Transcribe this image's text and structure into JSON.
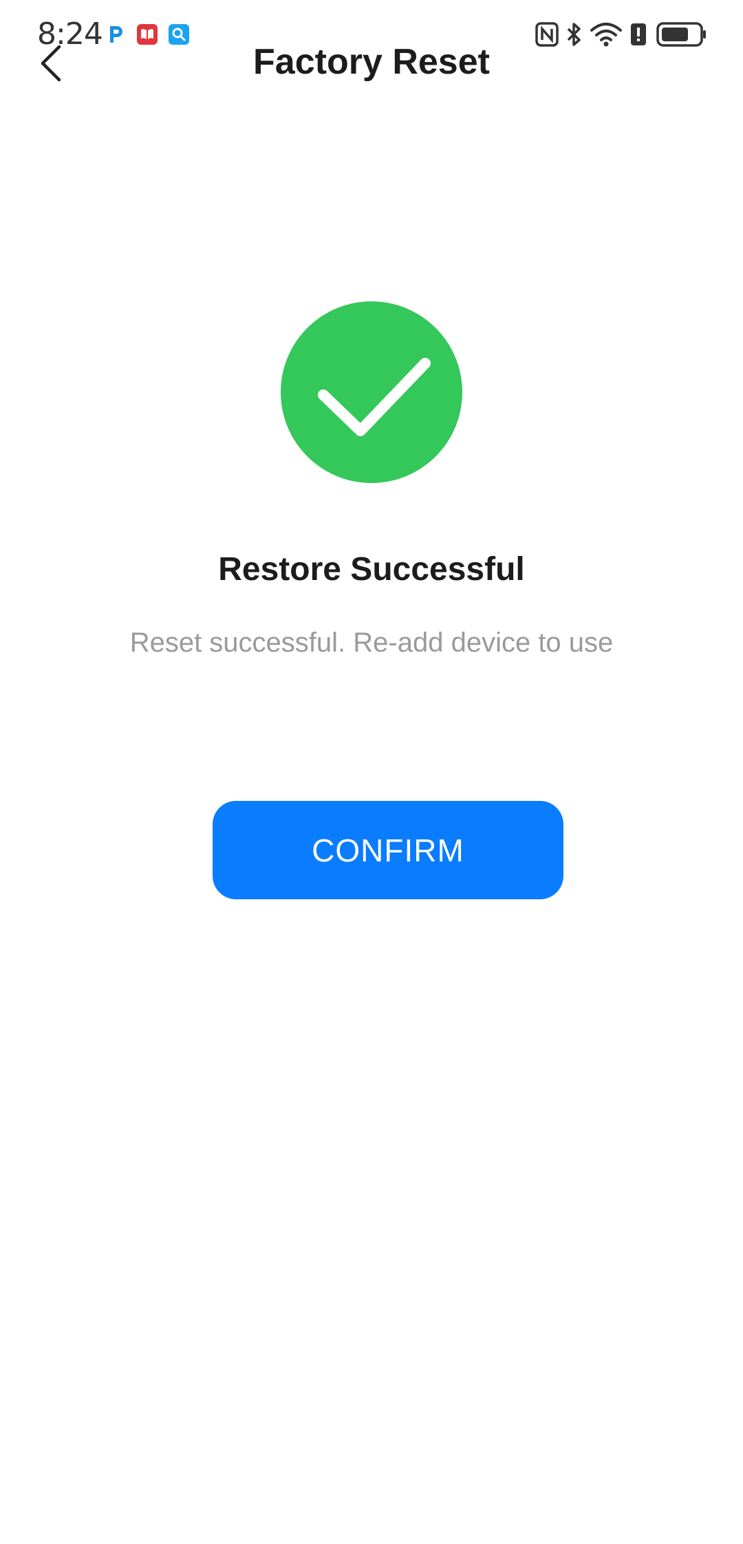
{
  "status_bar": {
    "time": "8:24",
    "notification_icons": [
      "p-app-icon",
      "book-app-icon",
      "search-app-icon"
    ],
    "system_icons": [
      "nfc-icon",
      "bluetooth-icon",
      "wifi-icon",
      "alert-icon",
      "battery-icon"
    ]
  },
  "header": {
    "title": "Factory Reset",
    "back_icon": "chevron-left-icon"
  },
  "result": {
    "icon": "check-circle-icon",
    "title": "Restore Successful",
    "message": "Reset successful. Re-add device to use"
  },
  "actions": {
    "confirm_label": "CONFIRM"
  },
  "colors": {
    "success": "#34c759",
    "primary": "#0a7cff",
    "title_text": "#1c1c1c",
    "secondary_text": "#9a9a9a"
  }
}
